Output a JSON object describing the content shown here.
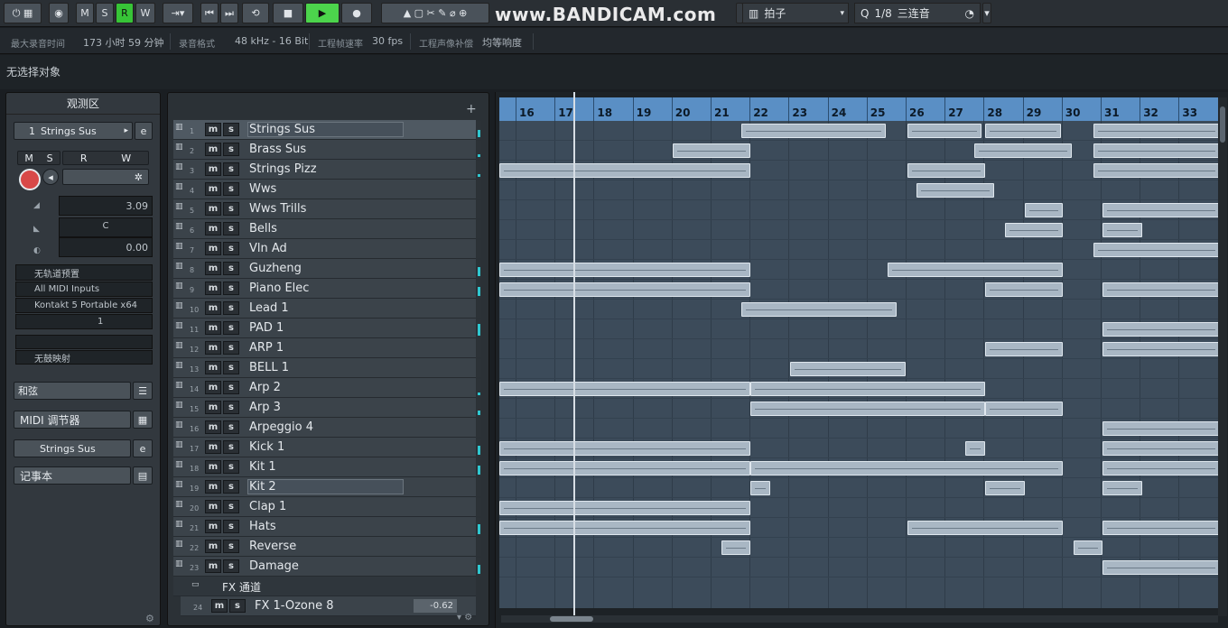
{
  "watermark": "www.BANDICAM.com",
  "toolbar": {
    "msrw": [
      "M",
      "S",
      "R",
      "W"
    ],
    "grid_type": "拍子",
    "quantize_label": "Q",
    "quantize_value": "1/8",
    "quantize_type": "三连音"
  },
  "info": {
    "rec_time_label": "最大录音时间",
    "rec_time_value": "173 小时 59 分钟",
    "rec_format_label": "录音格式",
    "rec_format_value": "48 kHz - 16 Bit",
    "frame_rate_label": "工程帧速率",
    "frame_rate_value": "30 fps",
    "pan_law_label": "工程声像补偿",
    "pan_law_value": "均等响度"
  },
  "selection_text": "无选择对象",
  "inspector": {
    "title": "观测区",
    "track_number": "1",
    "track_name": "Strings Sus",
    "buttons_ms": [
      "M",
      "S"
    ],
    "buttons_rw": [
      "R",
      "W"
    ],
    "volume_value": "3.09",
    "pan_value": "C",
    "delay_value": "0.00",
    "preset_placeholder": "无轨道预置",
    "input": "All MIDI Inputs",
    "output": "Kontakt 5 Portable x64",
    "channel": "1",
    "no_drum_map": "无鼓映射",
    "section_chords": "和弦",
    "section_midi": "MIDI 调节器",
    "section_instrument": "Strings Sus",
    "section_notepad": "记事本"
  },
  "tracks": [
    {
      "num": "1",
      "name": "Strings Sus",
      "meter": 0.5
    },
    {
      "num": "2",
      "name": "Brass Sus",
      "meter": 0.2
    },
    {
      "num": "3",
      "name": "Strings Pizz",
      "meter": 0.2
    },
    {
      "num": "4",
      "name": "Wws",
      "meter": 0
    },
    {
      "num": "5",
      "name": "Wws Trills",
      "meter": 0
    },
    {
      "num": "6",
      "name": "Bells",
      "meter": 0
    },
    {
      "num": "7",
      "name": "Vln Ad",
      "meter": 0
    },
    {
      "num": "8",
      "name": "Guzheng",
      "meter": 0.6
    },
    {
      "num": "9",
      "name": "Piano Elec",
      "meter": 0.6
    },
    {
      "num": "10",
      "name": "Lead 1",
      "meter": 0
    },
    {
      "num": "11",
      "name": "PAD 1",
      "meter": 0.8
    },
    {
      "num": "12",
      "name": "ARP 1",
      "meter": 0
    },
    {
      "num": "13",
      "name": "BELL 1",
      "meter": 0
    },
    {
      "num": "14",
      "name": "Arp 2",
      "meter": 0.2
    },
    {
      "num": "15",
      "name": "Arp 3",
      "meter": 0.3
    },
    {
      "num": "16",
      "name": "Arpeggio 4",
      "meter": 0
    },
    {
      "num": "17",
      "name": "Kick 1",
      "meter": 0.6
    },
    {
      "num": "18",
      "name": "Kit 1",
      "meter": 0.6
    },
    {
      "num": "19",
      "name": "Kit 2",
      "meter": 0
    },
    {
      "num": "20",
      "name": "Clap 1",
      "meter": 0
    },
    {
      "num": "21",
      "name": "Hats",
      "meter": 0.7
    },
    {
      "num": "22",
      "name": "Reverse",
      "meter": 0
    },
    {
      "num": "23",
      "name": "Damage",
      "meter": 0.6
    }
  ],
  "fx_folder": "FX 通道",
  "fx_track": {
    "num": "24",
    "name": "FX 1-Ozone 8",
    "value": "-0.62"
  },
  "ruler": [
    "16",
    "17",
    "18",
    "19",
    "20",
    "21",
    "22",
    "23",
    "24",
    "25",
    "26",
    "27",
    "28",
    "29",
    "30",
    "31",
    "32",
    "33"
  ]
}
